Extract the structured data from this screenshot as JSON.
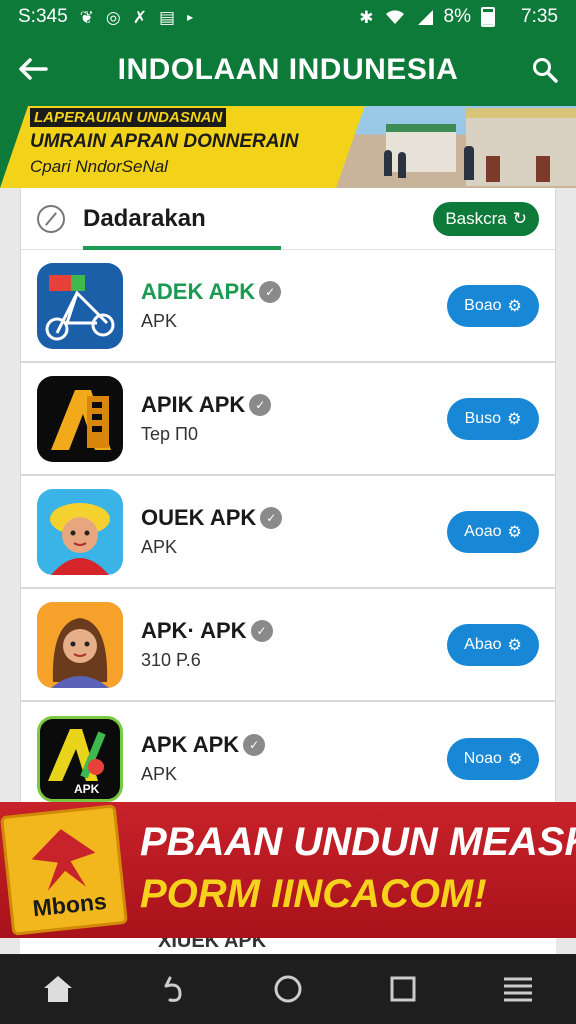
{
  "status_bar": {
    "time_left": "S:345",
    "battery": "8%",
    "time_right": "7:35"
  },
  "app_bar": {
    "title": "INDOLAAN INDUNESIA"
  },
  "banner": {
    "line1": "LAPERAUIAN UNDASNAN",
    "line2": "UMRAIN APRAN DONNERAIN",
    "line3": "Cpari NndorSeNal"
  },
  "section": {
    "title": "Dadarakan",
    "action_label": "Baskcra"
  },
  "apps": [
    {
      "name": "ADEK APK",
      "sub": "APK",
      "button": "Boao",
      "name_color": "#1a9a52"
    },
    {
      "name": "APIK APK",
      "sub": "Tep П0",
      "button": "Buso",
      "name_color": "#1a1a1a"
    },
    {
      "name": "OUEK APK",
      "sub": "APK",
      "button": "Aoao",
      "name_color": "#1a1a1a"
    },
    {
      "name": "APK· APK",
      "sub": "310 P.6",
      "button": "Abao",
      "name_color": "#1a1a1a"
    },
    {
      "name": "APK APK",
      "sub": "APK",
      "button": "Noao",
      "name_color": "#1a1a1a"
    }
  ],
  "ad": {
    "logo_text": "Mbons",
    "line1": "PBAAN UNDUN MEASK",
    "line2": "PORM IINCACOM!"
  },
  "peek": {
    "text": "XIUEK APK"
  },
  "colors": {
    "primary": "#0d7a3a",
    "accent_yellow": "#f2d31a",
    "button_blue": "#1787d6",
    "ad_red": "#c8222a"
  }
}
